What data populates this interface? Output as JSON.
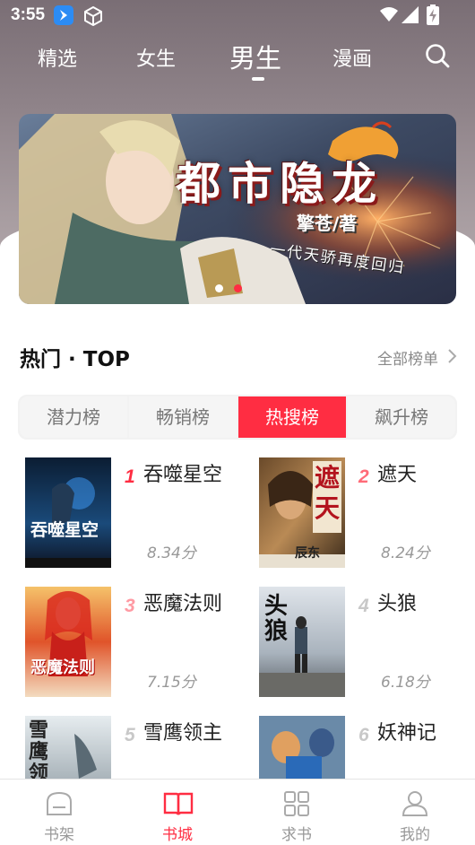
{
  "status_bar": {
    "time": "3:55"
  },
  "top_nav": {
    "tabs": [
      {
        "label": "精选"
      },
      {
        "label": "女生"
      },
      {
        "label": "男生"
      },
      {
        "label": "漫画"
      }
    ],
    "active_index": 2
  },
  "banner": {
    "title": "都市隐龙",
    "author": "擎苍/著",
    "tagline": "一代天骄再度回归",
    "dots": 2,
    "active_dot": 1
  },
  "section": {
    "title": "热门 · TOP",
    "more_label": "全部榜单"
  },
  "rank_tabs": [
    {
      "label": "潜力榜"
    },
    {
      "label": "畅销榜"
    },
    {
      "label": "热搜榜"
    },
    {
      "label": "飙升榜"
    }
  ],
  "rank_tabs_active_index": 2,
  "books": [
    {
      "rank": "1",
      "title": "吞噬星空",
      "score": "8.34分",
      "cover_text": "吞噬星空"
    },
    {
      "rank": "2",
      "title": "遮天",
      "score": "8.24分",
      "cover_text": "遮天",
      "cover_author": "辰东"
    },
    {
      "rank": "3",
      "title": "恶魔法则",
      "score": "7.15分",
      "cover_text": "恶魔法则"
    },
    {
      "rank": "4",
      "title": "头狼",
      "score": "6.18分",
      "cover_text": "头狼"
    },
    {
      "rank": "5",
      "title": "雪鹰领主",
      "score": "",
      "cover_text": "雪鹰领主"
    },
    {
      "rank": "6",
      "title": "妖神记",
      "score": "",
      "cover_text": ""
    }
  ],
  "bottom_nav": [
    {
      "label": "书架"
    },
    {
      "label": "书城"
    },
    {
      "label": "求书"
    },
    {
      "label": "我的"
    }
  ],
  "bottom_nav_active_index": 1,
  "colors": {
    "accent": "#ff2d42",
    "rank_1": "#ff2d42",
    "rank_2": "#ff6b78",
    "rank_3": "#ff9aa3",
    "rank_rest": "#c8c8c8"
  }
}
